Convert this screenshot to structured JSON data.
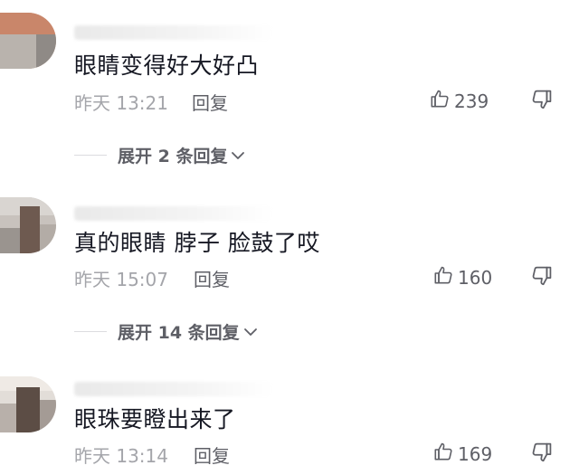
{
  "comments": [
    {
      "text": "眼睛变得好大好凸",
      "time": "昨天 13:21",
      "reply_label": "回复",
      "likes": "239",
      "expand_label": "展开 2 条回复"
    },
    {
      "text": "真的眼睛 脖子 脸鼓了哎",
      "time": "昨天 15:07",
      "reply_label": "回复",
      "likes": "160",
      "expand_label": "展开 14 条回复"
    },
    {
      "text": "眼珠要瞪出来了",
      "time": "昨天 13:14",
      "reply_label": "回复",
      "likes": "169"
    }
  ],
  "icons": {
    "like": "thumbs-up-icon",
    "dislike": "thumbs-down-icon",
    "expand": "chevron-down-icon"
  },
  "colors": {
    "primary_text": "#161823",
    "secondary_text": "#a4a5aa",
    "action_text": "#5e5f66"
  }
}
